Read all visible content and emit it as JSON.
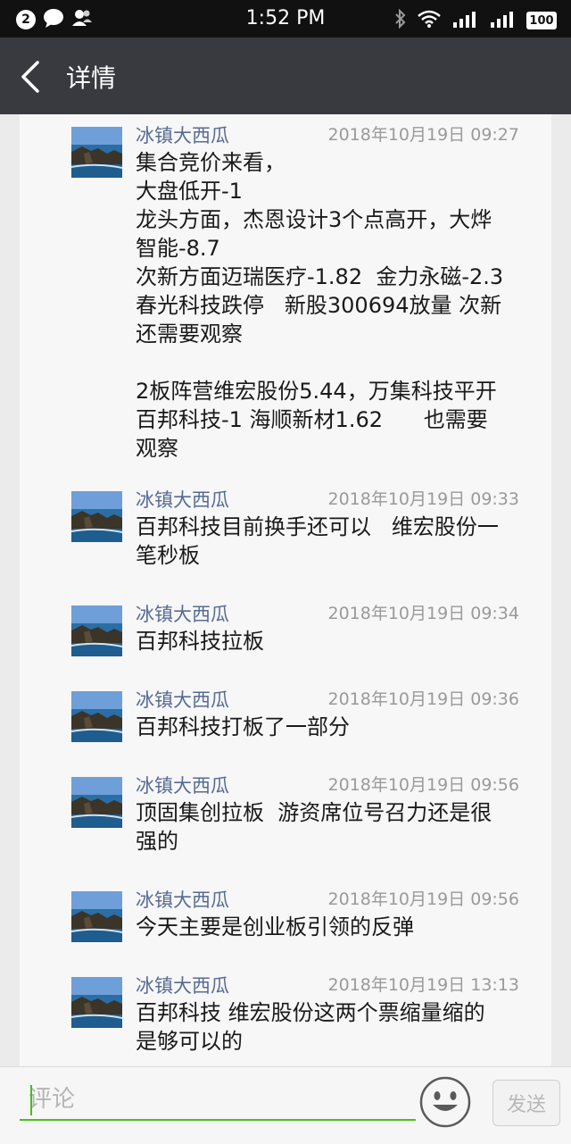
{
  "status_bar": {
    "notification_count": "2",
    "icons": [
      "chat-bubble-icon",
      "contacts-icon",
      "bluetooth-icon",
      "wifi-icon",
      "signal-icon"
    ],
    "time": "1:52 PM",
    "battery": "100"
  },
  "nav": {
    "back_icon": "chevron-left-icon",
    "title": "详情"
  },
  "comments": [
    {
      "author": "冰镇大西瓜",
      "time": "2018年10月19日 09:27",
      "text": "集合竞价来看，\n大盘低开-1\n龙头方面，杰恩设计3个点高开，大烨\n智能-8.7\n次新方面迈瑞医疗-1.82  金力永磁-2.3\n春光科技跌停   新股300694放量 次新\n还需要观察\n\n2板阵营维宏股份5.44，万集科技平开\n百邦科技-1 海顺新材1.62      也需要\n观察"
    },
    {
      "author": "冰镇大西瓜",
      "time": "2018年10月19日 09:33",
      "text": "百邦科技目前换手还可以   维宏股份一\n笔秒板"
    },
    {
      "author": "冰镇大西瓜",
      "time": "2018年10月19日 09:34",
      "text": "百邦科技拉板"
    },
    {
      "author": "冰镇大西瓜",
      "time": "2018年10月19日 09:36",
      "text": "百邦科技打板了一部分"
    },
    {
      "author": "冰镇大西瓜",
      "time": "2018年10月19日 09:56",
      "text": "顶固集创拉板  游资席位号召力还是很\n强的"
    },
    {
      "author": "冰镇大西瓜",
      "time": "2018年10月19日 09:56",
      "text": "今天主要是创业板引领的反弹"
    },
    {
      "author": "冰镇大西瓜",
      "time": "2018年10月19日 13:13",
      "text": "百邦科技 维宏股份这两个票缩量缩的\n是够可以的"
    }
  ],
  "input": {
    "placeholder": "评论",
    "emoji_icon": "smiley-icon",
    "send_label": "发送"
  },
  "colors": {
    "nav_bg": "#393a3f",
    "author_name": "#576b95",
    "input_underline": "#45c01a"
  }
}
